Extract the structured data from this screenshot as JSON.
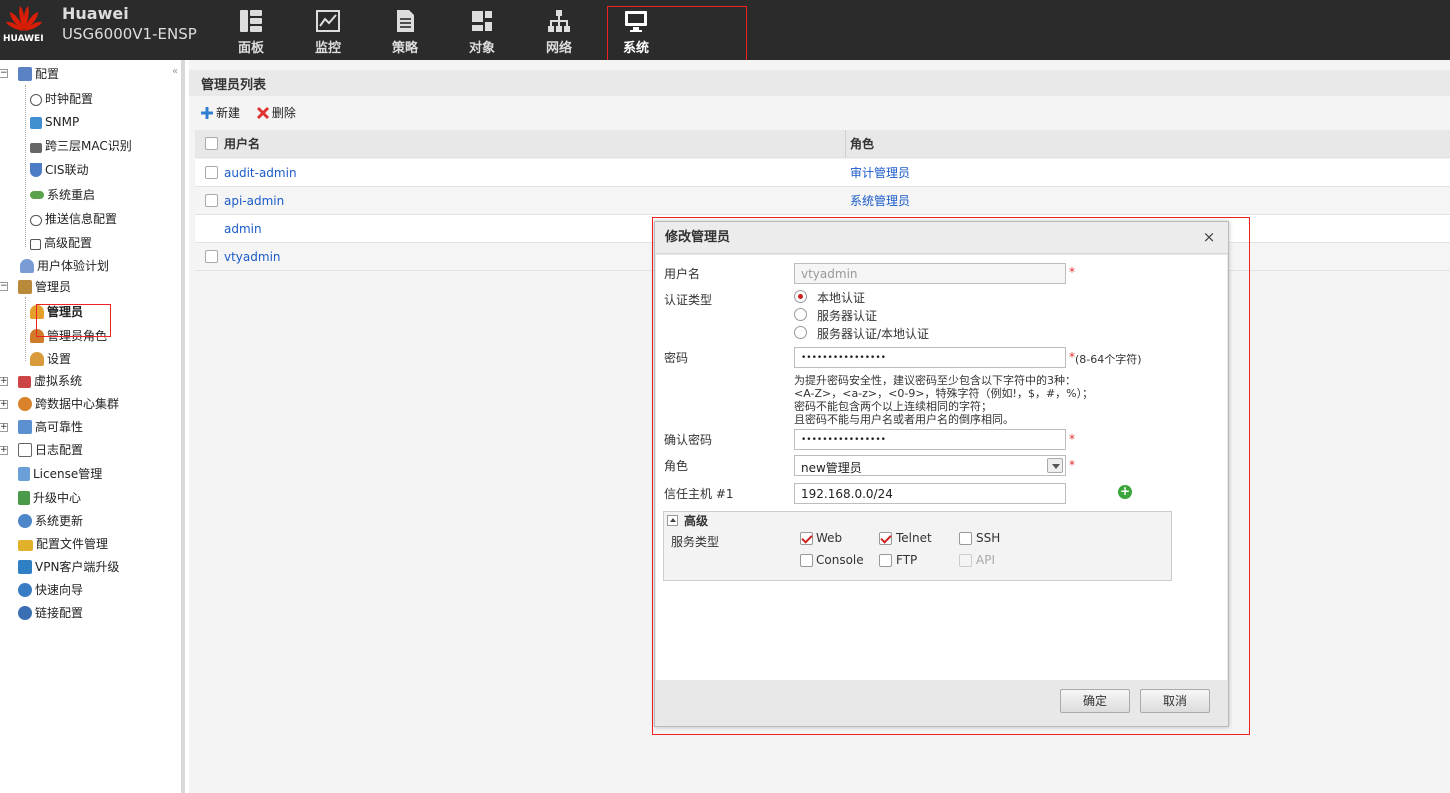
{
  "header": {
    "logo_text": "HUAWEI",
    "brand": "Huawei",
    "model": "USG6000V1-ENSP",
    "nav": [
      {
        "label": "面板",
        "icon": "dashboard-icon"
      },
      {
        "label": "监控",
        "icon": "monitor-chart-icon"
      },
      {
        "label": "策略",
        "icon": "policy-document-icon"
      },
      {
        "label": "对象",
        "icon": "object-icon"
      },
      {
        "label": "网络",
        "icon": "network-icon"
      },
      {
        "label": "系统",
        "icon": "system-display-icon"
      }
    ],
    "active_nav": "系统"
  },
  "sidebar": {
    "collapse": "«",
    "items": [
      {
        "label": "配置",
        "icon": "config-icon",
        "expanded": true
      },
      {
        "label": "时钟配置",
        "icon": "clock-icon"
      },
      {
        "label": "SNMP",
        "icon": "snmp-icon"
      },
      {
        "label": "跨三层MAC识别",
        "icon": "mac-icon"
      },
      {
        "label": "CIS联动",
        "icon": "cis-icon"
      },
      {
        "label": "系统重启",
        "icon": "restart-icon"
      },
      {
        "label": "推送信息配置",
        "icon": "push-message-icon"
      },
      {
        "label": "高级配置",
        "icon": "advanced-config-icon"
      },
      {
        "label": "用户体验计划",
        "icon": "user-experience-icon"
      },
      {
        "label": "管理员",
        "icon": "admin-group-icon",
        "expanded": true
      },
      {
        "label": "管理员",
        "icon": "admin-user-icon",
        "selected": true
      },
      {
        "label": "管理员角色",
        "icon": "admin-role-icon"
      },
      {
        "label": "设置",
        "icon": "settings-user-icon"
      },
      {
        "label": "虚拟系统",
        "icon": "virtual-system-icon"
      },
      {
        "label": "跨数据中心集群",
        "icon": "cluster-icon"
      },
      {
        "label": "高可靠性",
        "icon": "high-availability-icon"
      },
      {
        "label": "日志配置",
        "icon": "log-config-icon"
      },
      {
        "label": "License管理",
        "icon": "license-icon"
      },
      {
        "label": "升级中心",
        "icon": "upgrade-icon"
      },
      {
        "label": "系统更新",
        "icon": "system-update-icon"
      },
      {
        "label": "配置文件管理",
        "icon": "config-file-icon"
      },
      {
        "label": "VPN客户端升级",
        "icon": "vpn-client-icon"
      },
      {
        "label": "快速向导",
        "icon": "quick-wizard-icon"
      },
      {
        "label": "链接配置",
        "icon": "link-config-icon"
      }
    ]
  },
  "main": {
    "panel_title": "管理员列表",
    "toolbar": {
      "new": "新建",
      "delete": "删除"
    },
    "table": {
      "headers": [
        "用户名",
        "角色"
      ],
      "rows": [
        {
          "username": "audit-admin",
          "role": "审计管理员",
          "checkbox": true
        },
        {
          "username": "api-admin",
          "role": "系统管理员",
          "checkbox": true
        },
        {
          "username": "admin",
          "role": "",
          "checkbox": false
        },
        {
          "username": "vtyadmin",
          "role": "",
          "checkbox": true
        }
      ]
    }
  },
  "dialog": {
    "title": "修改管理员",
    "close": "×",
    "username_label": "用户名",
    "username_value": "vtyadmin",
    "auth_label": "认证类型",
    "auth_options": [
      "本地认证",
      "服务器认证",
      "服务器认证/本地认证"
    ],
    "auth_selected": 0,
    "password_label": "密码",
    "password_value": "••••••••••••••••",
    "password_hint": "(8-64个字符)",
    "password_tips": [
      "为提升密码安全性，建议密码至少包含以下字符中的3种：",
      "<A-Z>，<a-z>，<0-9>，特殊字符（例如!，$，#，%）；",
      "密码不能包含两个以上连续相同的字符；",
      "且密码不能与用户名或者用户名的倒序相同。"
    ],
    "confirm_label": "确认密码",
    "confirm_value": "••••••••••••••••",
    "role_label": "角色",
    "role_value": "new管理员",
    "trusted_label": "信任主机 #1",
    "trusted_value": "192.168.0.0/24",
    "advanced_label": "高级",
    "service_label": "服务类型",
    "services": [
      {
        "label": "Web",
        "checked": true,
        "disabled": false
      },
      {
        "label": "Telnet",
        "checked": true,
        "disabled": false
      },
      {
        "label": "SSH",
        "checked": false,
        "disabled": false
      },
      {
        "label": "Console",
        "checked": false,
        "disabled": false
      },
      {
        "label": "FTP",
        "checked": false,
        "disabled": false
      },
      {
        "label": "API",
        "checked": false,
        "disabled": true
      }
    ],
    "ok": "确定",
    "cancel": "取消"
  },
  "colors": {
    "header_bg": "#2b2b2b",
    "link": "#1a5bc9",
    "required": "#e03030",
    "highlight_box": "#e22222"
  }
}
